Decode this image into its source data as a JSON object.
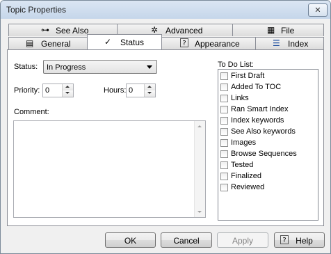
{
  "window": {
    "title": "Topic Properties",
    "close_glyph": "✕"
  },
  "tabs_back": [
    {
      "label": "See Also",
      "icon": "see-also-icon"
    },
    {
      "label": "Advanced",
      "icon": "gear-icon"
    },
    {
      "label": "File",
      "icon": "file-icon"
    }
  ],
  "tabs_front": [
    {
      "label": "General",
      "icon": "general-icon"
    },
    {
      "label": "Status",
      "icon": "checkmark-icon",
      "active": true
    },
    {
      "label": "Appearance",
      "icon": "help-icon"
    },
    {
      "label": "Index",
      "icon": "index-icon"
    }
  ],
  "status": {
    "label": "Status:",
    "value": "In Progress"
  },
  "priority": {
    "label": "Priority:",
    "value": "0"
  },
  "hours": {
    "label": "Hours:",
    "value": "0"
  },
  "comment": {
    "label": "Comment:",
    "value": ""
  },
  "todo": {
    "label": "To Do List:",
    "items": [
      "First Draft",
      "Added To TOC",
      "Links",
      "Ran Smart Index",
      "Index keywords",
      "See Also keywords",
      "Images",
      "Browse Sequences",
      "Tested",
      "Finalized",
      "Reviewed"
    ]
  },
  "buttons": {
    "ok": "OK",
    "cancel": "Cancel",
    "apply": "Apply",
    "help": "Help"
  }
}
